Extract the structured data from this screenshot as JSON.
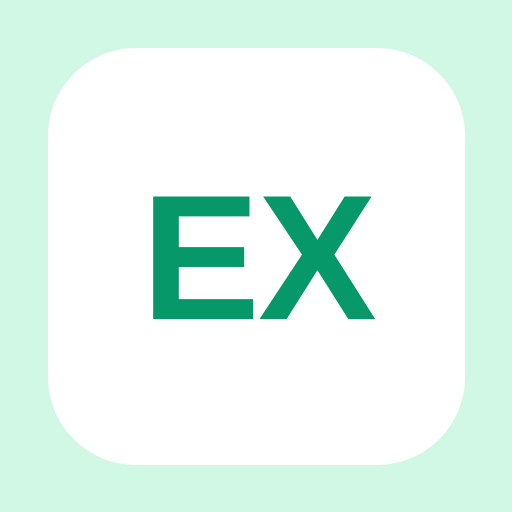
{
  "app_icon": {
    "text": "EX",
    "colors": {
      "background": "#d1f8e5",
      "tile": "#ffffff",
      "text": "#079869"
    }
  }
}
